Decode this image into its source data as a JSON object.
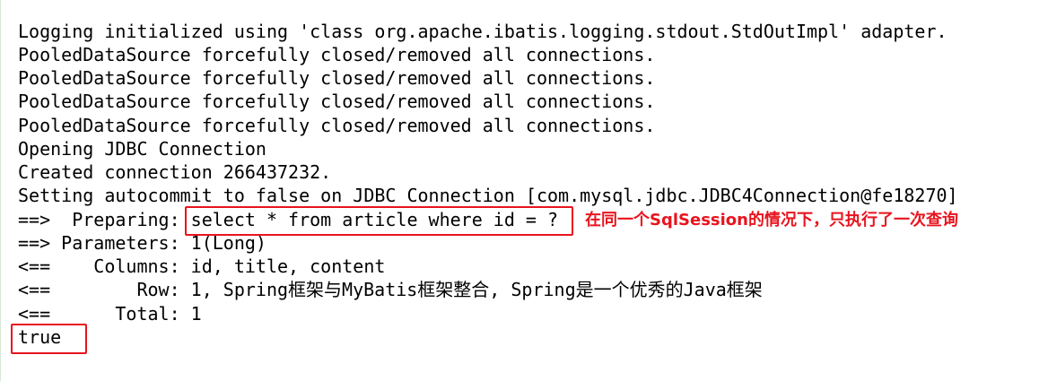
{
  "console": {
    "lines": [
      "Logging initialized using 'class org.apache.ibatis.logging.stdout.StdOutImpl' adapter.",
      "PooledDataSource forcefully closed/removed all connections.",
      "PooledDataSource forcefully closed/removed all connections.",
      "PooledDataSource forcefully closed/removed all connections.",
      "PooledDataSource forcefully closed/removed all connections.",
      "Opening JDBC Connection",
      "Created connection 266437232.",
      "Setting autocommit to false on JDBC Connection [com.mysql.jdbc.JDBC4Connection@fe18270]",
      "==>  Preparing: select * from article where id = ? ",
      "==> Parameters: 1(Long)",
      "<==    Columns: id, title, content",
      "<==        Row: 1, Spring框架与MyBatis框架整合, Spring是一个优秀的Java框架",
      "<==      Total: 1",
      "true"
    ]
  },
  "annotation": {
    "text": "在同一个SqlSession的情况下，只执行了一次查询",
    "color": "#e8141e"
  }
}
